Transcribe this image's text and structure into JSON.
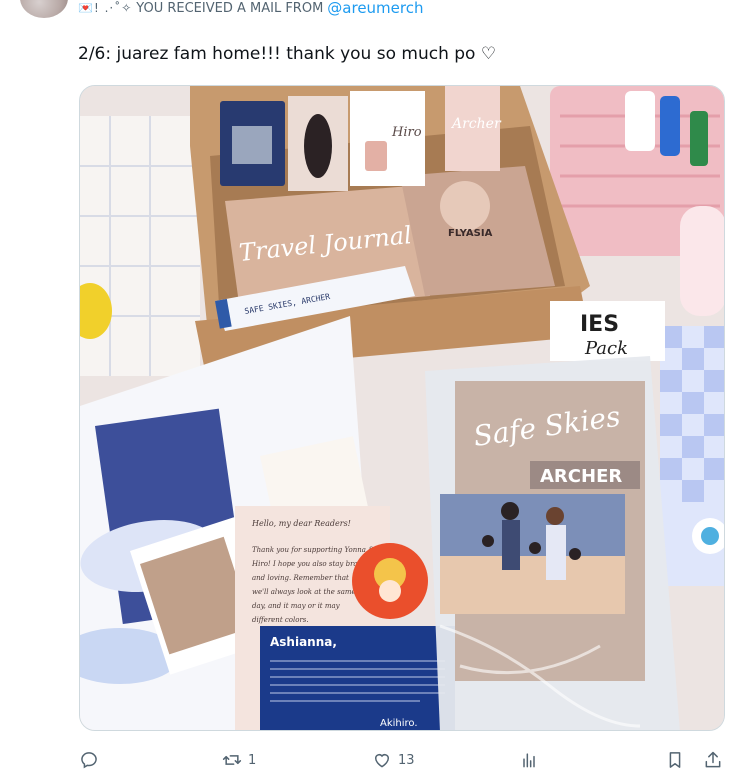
{
  "header": {
    "decorations": "💌! .·˚✧",
    "received_text": "YOU RECEIVED A MAIL FROM",
    "mention": "@areumerch"
  },
  "tweet": {
    "text": "2/6:  juarez fam home!!! thank you so much po ♡"
  },
  "media": {
    "box_text": {
      "travel_journal": "Travel Journal",
      "ticket": "SAFE SKIES, ARCHER",
      "flyasia": "FLYASIA",
      "archer_card": "Archer",
      "hiro_card": "Hiro",
      "pack_sign_1": "IES",
      "pack_sign_2": "Pack",
      "book_title": "Safe Skies",
      "book_sub": "ARCHER",
      "letter_greeting": "Hello, my dear Readers!",
      "letter_body_1": "Thank you for supporting Yonna &",
      "letter_body_2": "Hiro! I hope you also stay brave",
      "letter_body_3": "and loving. Remember that",
      "letter_body_4": "we'll always look at the same",
      "letter_body_5": "day, and it may or it may",
      "letter_body_6": "different colors.",
      "blue_card_name": "Ashianna,",
      "blue_card_sign": "Akihiro."
    }
  },
  "actions": {
    "reply_count": "",
    "retweet_count": "1",
    "like_count": "13",
    "views_count": "",
    "colors": {
      "icon": "#536471"
    }
  }
}
